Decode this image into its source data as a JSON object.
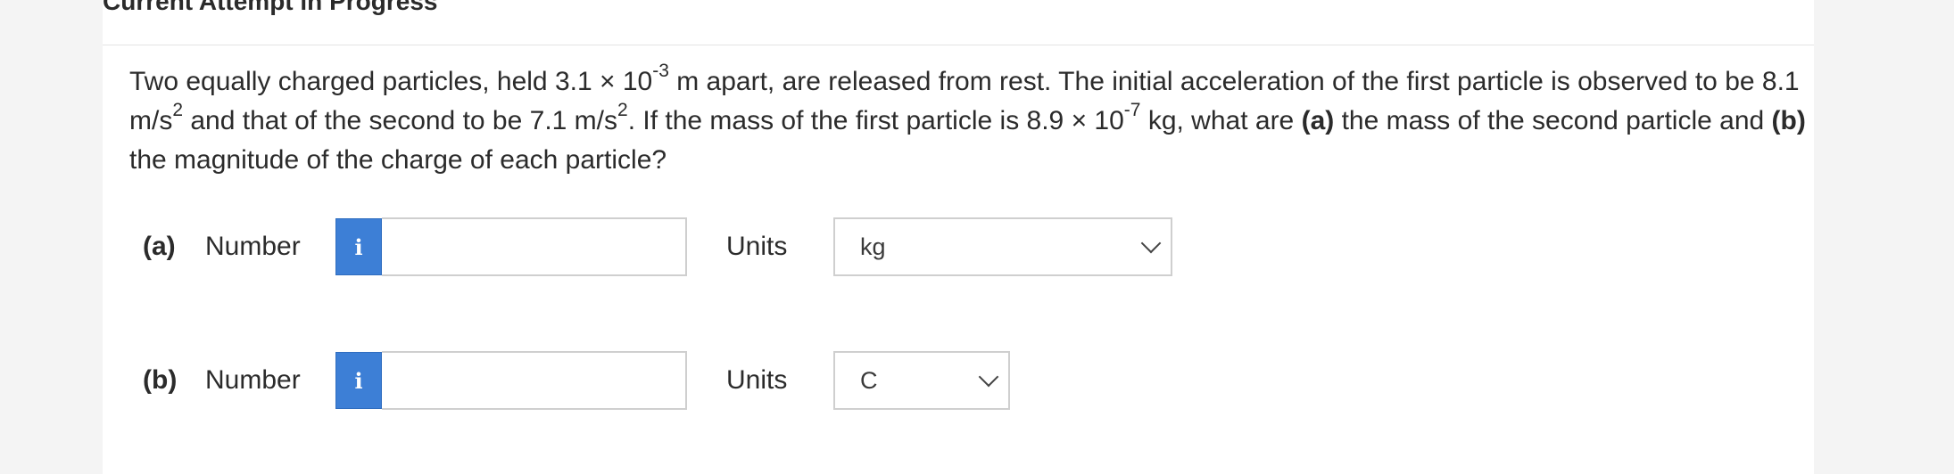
{
  "header": {
    "title": "Current Attempt in Progress"
  },
  "question": {
    "line1_part1": "Two equally charged particles, held 3.1 × 10",
    "line1_exp1": "-3",
    "line1_part2": " m apart, are released from rest. The initial acceleration of the first particle is observed to be 8.1 m/s",
    "exp_sq1": "2",
    "part3": " and that of the second to be 7.1 m/s",
    "exp_sq2": "2",
    "part4": ". If the mass of the first particle is 8.9 × 10",
    "exp_mass": "-7",
    "part5": " kg, what are ",
    "bold_a": "(a)",
    "part6": " the mass of the second particle and ",
    "bold_b": "(b)",
    "part7": " the magnitude of the charge of each particle?"
  },
  "answers": [
    {
      "part_label": "(a)",
      "number_label": "Number",
      "info_icon_glyph": "i",
      "number_value": "",
      "units_label": "Units",
      "units_selected": "kg"
    },
    {
      "part_label": "(b)",
      "number_label": "Number",
      "info_icon_glyph": "i",
      "number_value": "",
      "units_label": "Units",
      "units_selected": "C"
    }
  ],
  "colors": {
    "info_button": "#3d7fd6",
    "panel_bg": "#ffffff",
    "page_bg": "#f4f4f4"
  }
}
